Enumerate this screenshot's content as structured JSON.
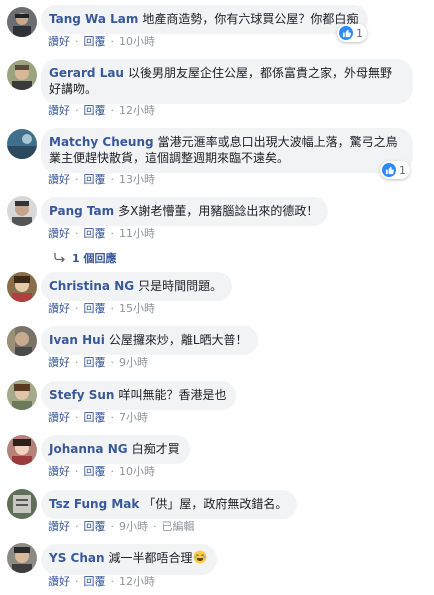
{
  "comments": [
    {
      "author": "Tang Wa Lam",
      "text": "地產商造勢，你有六球買公屋？你都白痴",
      "like": "讚好",
      "reply": "回覆",
      "time": "10小時",
      "reaction_count": "1"
    },
    {
      "author": "Gerard Lau",
      "text_line1": "以後男朋友屋企住公屋，都係富貴之家，外母無野",
      "text_line2": "好講吻。",
      "like": "讚好",
      "reply": "回覆",
      "time": "12小時"
    },
    {
      "author": "Matchy Cheung",
      "text_line1": "當港元滙率或息口出現大波幅上落，驚弓之鳥",
      "text_line2": "業主便趕快散貨，這個調整週期來臨不遠矣。",
      "like": "讚好",
      "reply": "回覆",
      "time": "13小時",
      "reaction_count": "1"
    },
    {
      "author": "Pang Tam",
      "text": "多X謝老懵董，用豬腦諗出來的德政！",
      "like": "讚好",
      "reply": "回覆",
      "time": "11小時",
      "replies_label": "1 個回應"
    },
    {
      "author": "Christina NG",
      "text": "只是時間問題。",
      "like": "讚好",
      "reply": "回覆",
      "time": "15小時"
    },
    {
      "author": "Ivan Hui",
      "text": "公屋攞來炒，離L晒大普！",
      "like": "讚好",
      "reply": "回覆",
      "time": "9小時"
    },
    {
      "author": "Stefy Sun",
      "text": "咩叫無能？香港是也",
      "like": "讚好",
      "reply": "回覆",
      "time": "7小時"
    },
    {
      "author": "Johanna NG",
      "text": "白痴才買",
      "like": "讚好",
      "reply": "回覆",
      "time": "10小時"
    },
    {
      "author": "Tsz Fung Mak",
      "text": "「供」屋，政府無改錯名。",
      "like": "讚好",
      "reply": "回覆",
      "time": "9小時",
      "edited": "已編輯"
    },
    {
      "author": "YS Chan",
      "text": "減一半都唔合理",
      "like": "讚好",
      "reply": "回覆",
      "time": "12小時"
    }
  ],
  "colors": {
    "link": "#385898",
    "bubble": "#f2f3f5",
    "like_badge": "#2e89ff"
  },
  "icons": {
    "reaction": "thumbs-up-icon",
    "reply_arrow": "reply-arrow-icon",
    "emoji": "laughing-tears-emoji-icon"
  }
}
